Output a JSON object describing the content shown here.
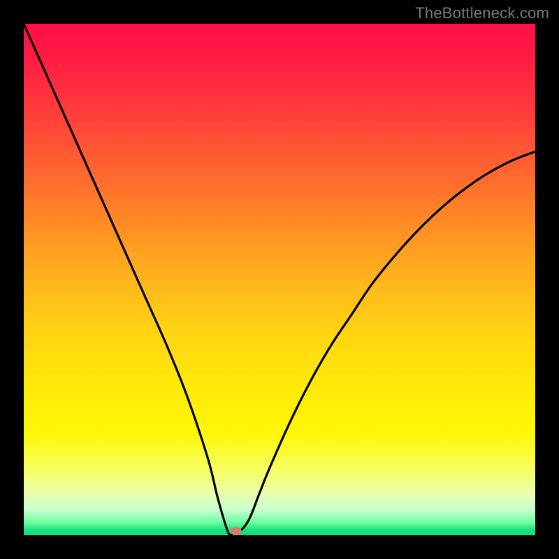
{
  "watermark": "TheBottleneck.com",
  "chart_data": {
    "type": "line",
    "title": "",
    "xlabel": "",
    "ylabel": "",
    "xlim": [
      0,
      100
    ],
    "ylim": [
      0,
      100
    ],
    "grid": false,
    "legend": false,
    "series": [
      {
        "name": "curve",
        "x": [
          0,
          4,
          8,
          12,
          16,
          20,
          24,
          28,
          32,
          36,
          38,
          40,
          41,
          42,
          44,
          46,
          48,
          52,
          56,
          60,
          64,
          68,
          72,
          76,
          80,
          84,
          88,
          92,
          96,
          100
        ],
        "y": [
          100,
          91,
          82,
          73,
          64,
          55,
          46,
          37,
          27,
          15,
          7,
          0.5,
          0.5,
          0.5,
          3,
          8,
          13,
          22,
          30,
          37,
          43,
          49,
          54,
          58.5,
          62.5,
          66,
          69,
          71.5,
          73.5,
          75
        ]
      }
    ],
    "marker": {
      "x": 41.5,
      "y": 0.8,
      "color": "#d67a72"
    },
    "gradient_stops": [
      {
        "pos": 0,
        "color": "#ff0f46"
      },
      {
        "pos": 0.18,
        "color": "#ff3f3a"
      },
      {
        "pos": 0.4,
        "color": "#ff8f25"
      },
      {
        "pos": 0.6,
        "color": "#ffd313"
      },
      {
        "pos": 0.8,
        "color": "#fff705"
      },
      {
        "pos": 0.95,
        "color": "#c8ffd0"
      },
      {
        "pos": 1.0,
        "color": "#13e07a"
      }
    ]
  }
}
